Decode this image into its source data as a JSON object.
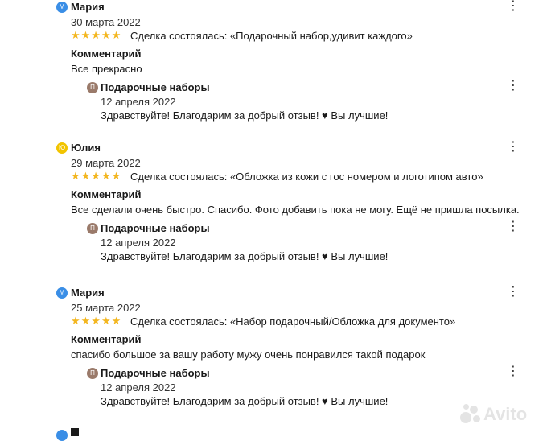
{
  "reviews": [
    {
      "avatar_letter": "М",
      "avatar_color": "#3a8ee6",
      "name": "Мария",
      "date": "30 марта 2022",
      "stars": "★★★★★",
      "deal": "Сделка состоялась: «Подарочный набор,удивит каждого»",
      "comment_title": "Комментарий",
      "comment": "Все прекрасно",
      "reply": {
        "avatar_letter": "П",
        "name": "Подарочные наборы",
        "date": "12 апреля 2022",
        "text": "Здравствуйте! Благодарим за добрый отзыв! ♥ Вы лучшие!"
      }
    },
    {
      "avatar_letter": "Ю",
      "avatar_color": "#f2c400",
      "name": "Юлия",
      "date": "29 марта 2022",
      "stars": "★★★★★",
      "deal": "Сделка состоялась: «Обложка из кожи с гос номером и логотипом авто»",
      "comment_title": "Комментарий",
      "comment": "Все сделали очень быстро. Спасибо. Фото добавить пока не могу. Ещё не пришла посылка.",
      "reply": {
        "avatar_letter": "П",
        "name": "Подарочные наборы",
        "date": "12 апреля 2022",
        "text": "Здравствуйте! Благодарим за добрый отзыв! ♥ Вы лучшие!"
      }
    },
    {
      "avatar_letter": "М",
      "avatar_color": "#3a8ee6",
      "name": "Мария",
      "date": "25 марта 2022",
      "stars": "★★★★★",
      "deal": "Сделка состоялась: «Набор подарочный/Обложка для документо»",
      "comment_title": "Комментарий",
      "comment": "спасибо большое за вашу работу мужу очень понравился такой подарок",
      "reply": {
        "avatar_letter": "П",
        "name": "Подарочные наборы",
        "date": "12 апреля 2022",
        "text": "Здравствуйте! Благодарим за добрый отзыв! ♥ Вы лучшие!"
      }
    }
  ],
  "menu_icon": "⋮",
  "watermark": "Avito",
  "colors": {
    "star": "#f3b61f",
    "reply_avatar": "#9a7a6a"
  }
}
